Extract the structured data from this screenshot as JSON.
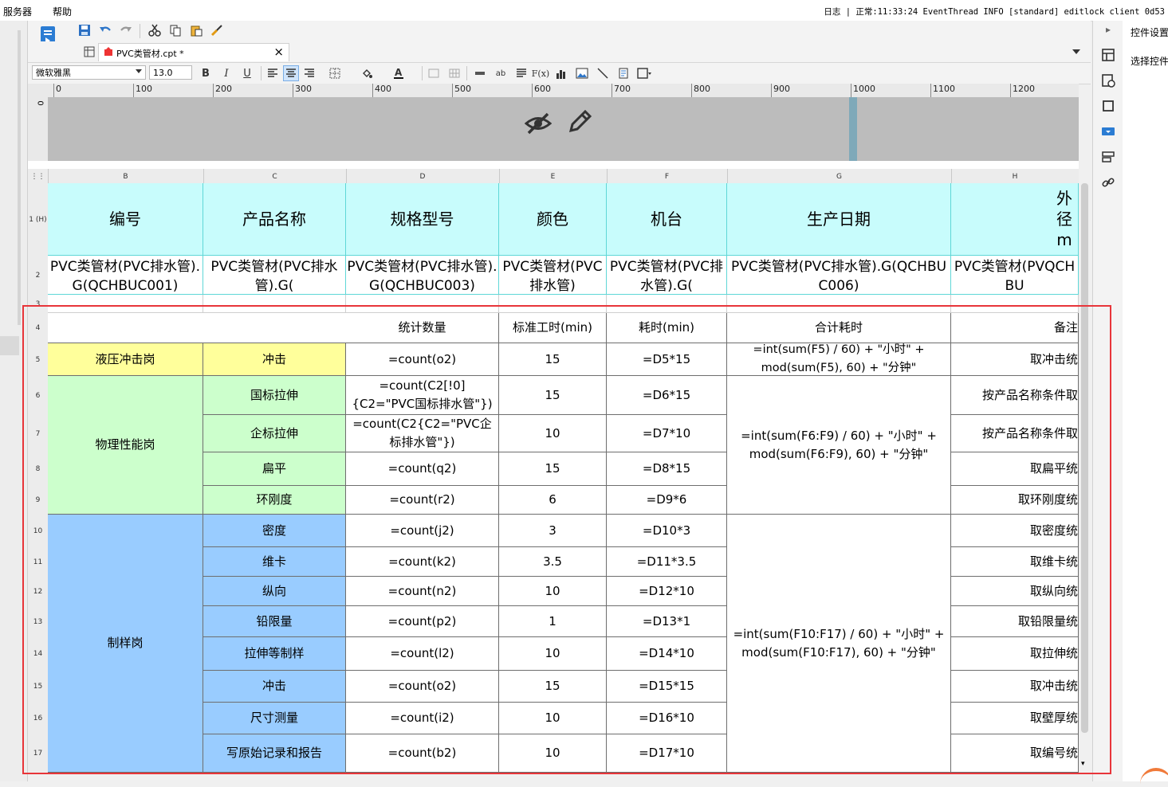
{
  "menubar": {
    "items": [
      "服务器",
      "帮助"
    ],
    "log_label": "日志",
    "status_text": "正常:11:33:24 EventThread INFO [standard] editlock client 0d53"
  },
  "toolbar": {
    "icons": [
      "save-icon",
      "undo-icon",
      "redo-icon",
      "cut-icon",
      "copy-icon",
      "paste-icon",
      "format-painter-icon"
    ]
  },
  "tab": {
    "title": "PVC类管材.cpt *",
    "close": "×"
  },
  "format_bar": {
    "font_name": "微软雅黑",
    "font_size": "13.0",
    "bold": "B",
    "italic": "I",
    "underline": "U"
  },
  "ruler": {
    "labels": [
      "0",
      "100",
      "200",
      "300",
      "400",
      "500",
      "600",
      "700",
      "800",
      "900",
      "1000",
      "1100",
      "1200"
    ],
    "v_label": "0"
  },
  "columns": [
    "B",
    "C",
    "D",
    "E",
    "F",
    "G",
    "H"
  ],
  "rows": [
    "1 (H)",
    "2",
    "3",
    "4",
    "5",
    "6",
    "7",
    "8",
    "9",
    "10",
    "11",
    "12",
    "13",
    "14",
    "15",
    "16",
    "17"
  ],
  "header_row": [
    "编号",
    "产品名称",
    "规格型号",
    "颜色",
    "机台",
    "生产日期",
    "外径\nm"
  ],
  "row2": [
    "PVC类管材(PVC排水管).G(QCHBUC001)",
    "PVC类管材(PVC排水管).G(",
    "PVC类管材(PVC排水管).G(QCHBUC003)",
    "PVC类管材(PVC排水管)",
    "PVC类管材(PVC排水管).G(",
    "PVC类管材(PVC排水管).G(QCHBUC006)",
    "PVC类管材(PVQCHBU"
  ],
  "row4": {
    "stat_count": "统计数量",
    "std_time": "标准工时(min)",
    "time_cost": "耗时(min)",
    "total_time": "合计耗时",
    "note": "备注"
  },
  "groups": {
    "hydraulic": "液压冲击岗",
    "physical": "物理性能岗",
    "sample": "制样岗"
  },
  "items": [
    {
      "name": "冲击",
      "count": "=count(o2)",
      "std": "15",
      "cost": "=D5*15",
      "note": "取冲击统"
    },
    {
      "name": "国标拉伸",
      "count": "=count(C2[!0]{C2=\"PVC国标排水管\"})",
      "std": "15",
      "cost": "=D6*15",
      "note": "按产品名称条件取"
    },
    {
      "name": "企标拉伸",
      "count": "=count(C2{C2=\"PVC企标排水管\"})",
      "std": "10",
      "cost": "=D7*10",
      "note": "按产品名称条件取"
    },
    {
      "name": "扁平",
      "count": "=count(q2)",
      "std": "15",
      "cost": "=D8*15",
      "note": "取扁平统"
    },
    {
      "name": "环刚度",
      "count": "=count(r2)",
      "std": "6",
      "cost": "=D9*6",
      "note": "取环刚度统"
    },
    {
      "name": "密度",
      "count": "=count(j2)",
      "std": "3",
      "cost": "=D10*3",
      "note": "取密度统"
    },
    {
      "name": "维卡",
      "count": "=count(k2)",
      "std": "3.5",
      "cost": "=D11*3.5",
      "note": "取维卡统"
    },
    {
      "name": "纵向",
      "count": "=count(n2)",
      "std": "10",
      "cost": "=D12*10",
      "note": "取纵向统"
    },
    {
      "name": "铅限量",
      "count": "=count(p2)",
      "std": "1",
      "cost": "=D13*1",
      "note": "取铅限量统"
    },
    {
      "name": "拉伸等制样",
      "count": "=count(l2)",
      "std": "10",
      "cost": "=D14*10",
      "note": "取拉伸统"
    },
    {
      "name": "冲击",
      "count": "=count(o2)",
      "std": "15",
      "cost": "=D15*15",
      "note": "取冲击统"
    },
    {
      "name": "尺寸测量",
      "count": "=count(i2)",
      "std": "10",
      "cost": "=D16*10",
      "note": "取壁厚统"
    },
    {
      "name": "写原始记录和报告",
      "count": "=count(b2)",
      "std": "10",
      "cost": "=D17*10",
      "note": "取编号统"
    }
  ],
  "totals": {
    "g5": "=int(sum(F5) / 60) + \"小时\" + mod(sum(F5), 60) + \"分钟\"",
    "g6": "=int(sum(F6:F9) / 60) + \"小时\" + mod(sum(F6:F9), 60) + \"分钟\"",
    "g10": "=int(sum(F10:F17) / 60) + \"小时\" + mod(sum(F10:F17), 60) + \"分钟\""
  },
  "right_panel": {
    "tab1": "控件设置",
    "tab2": "选择控件"
  },
  "colors": {
    "header_cyan": "#c8fcfc",
    "yellow": "#ffff9b",
    "green": "#ccffcc",
    "blue": "#99ccff",
    "highlight_red": "#e8353a"
  }
}
